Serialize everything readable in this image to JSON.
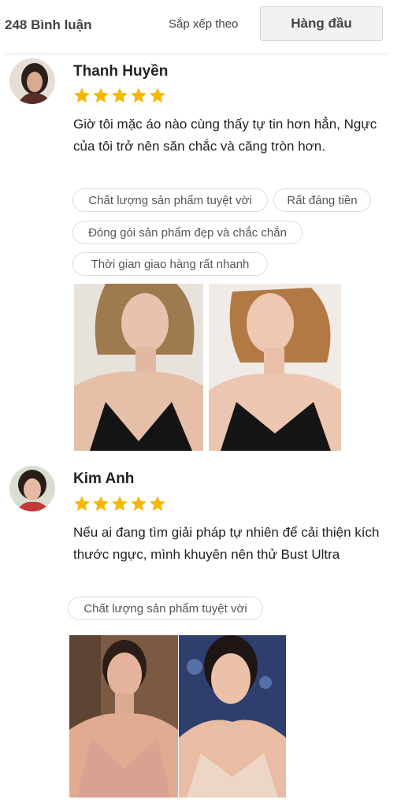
{
  "header": {
    "review_count": "248 Bình luận",
    "sort_label": "Sắp xếp theo",
    "sort_selected": "Hàng đầu"
  },
  "colors": {
    "star": "#f5b800",
    "tag_border": "#dcdcdc",
    "select_bg": "#f1f1f1"
  },
  "reviews": [
    {
      "name": "Thanh Huyền",
      "rating": 5,
      "text": "Giờ tôi mặc áo nào cùng thấy tự tin hơn hẳn, Ngực của tôi trở nên săn chắc và căng tròn hơn.",
      "tags": [
        "Chất lượng sản phẩm tuyệt vời",
        "Rất đáng tiền",
        "Đóng gói sản phẩm đẹp và chắc chắn",
        "Thời gian giao hàng rất nhanh"
      ]
    },
    {
      "name": "Kim Anh",
      "rating": 5,
      "text": "Nếu ai đang tìm giải pháp tự nhiên để cải thiện kích thước ngực, mình khuyên nên thử Bust Ultra",
      "tags": [
        "Chất lượng sản phẩm tuyệt vời"
      ]
    }
  ]
}
